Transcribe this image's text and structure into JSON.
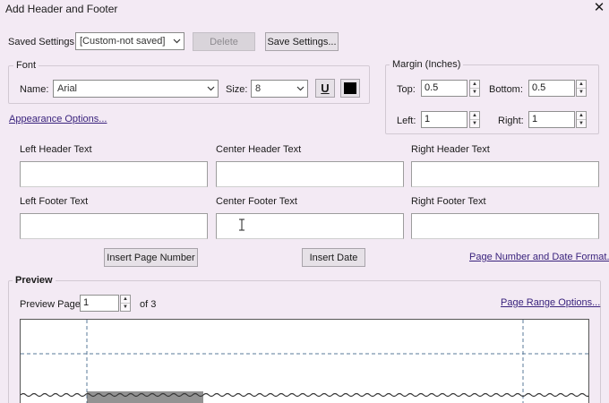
{
  "window": {
    "title": "Add Header and Footer"
  },
  "saved_settings": {
    "label": "Saved Settings:",
    "value": "[Custom-not saved]",
    "delete_label": "Delete",
    "save_label": "Save Settings..."
  },
  "font": {
    "group_label": "Font",
    "name_label": "Name:",
    "name_value": "Arial",
    "size_label": "Size:",
    "size_value": "8",
    "underline_label": "U",
    "color_hex": "#000000"
  },
  "margin": {
    "group_label": "Margin (Inches)",
    "top_label": "Top:",
    "top_value": "0.5",
    "bottom_label": "Bottom:",
    "bottom_value": "0.5",
    "left_label": "Left:",
    "left_value": "1",
    "right_label": "Right:",
    "right_value": "1"
  },
  "appearance_link": "Appearance Options...",
  "header": {
    "left_label": "Left Header Text",
    "center_label": "Center Header Text",
    "right_label": "Right Header Text"
  },
  "footer": {
    "left_label": "Left Footer Text",
    "center_label": "Center Footer Text",
    "right_label": "Right Footer Text"
  },
  "insert_page_number_label": "Insert Page Number",
  "insert_date_label": "Insert Date",
  "page_number_format_link": "Page Number and Date Format...",
  "preview": {
    "group_label": "Preview",
    "page_label": "Preview Page",
    "page_value": "1",
    "of_label": "of 3",
    "range_link": "Page Range Options..."
  }
}
